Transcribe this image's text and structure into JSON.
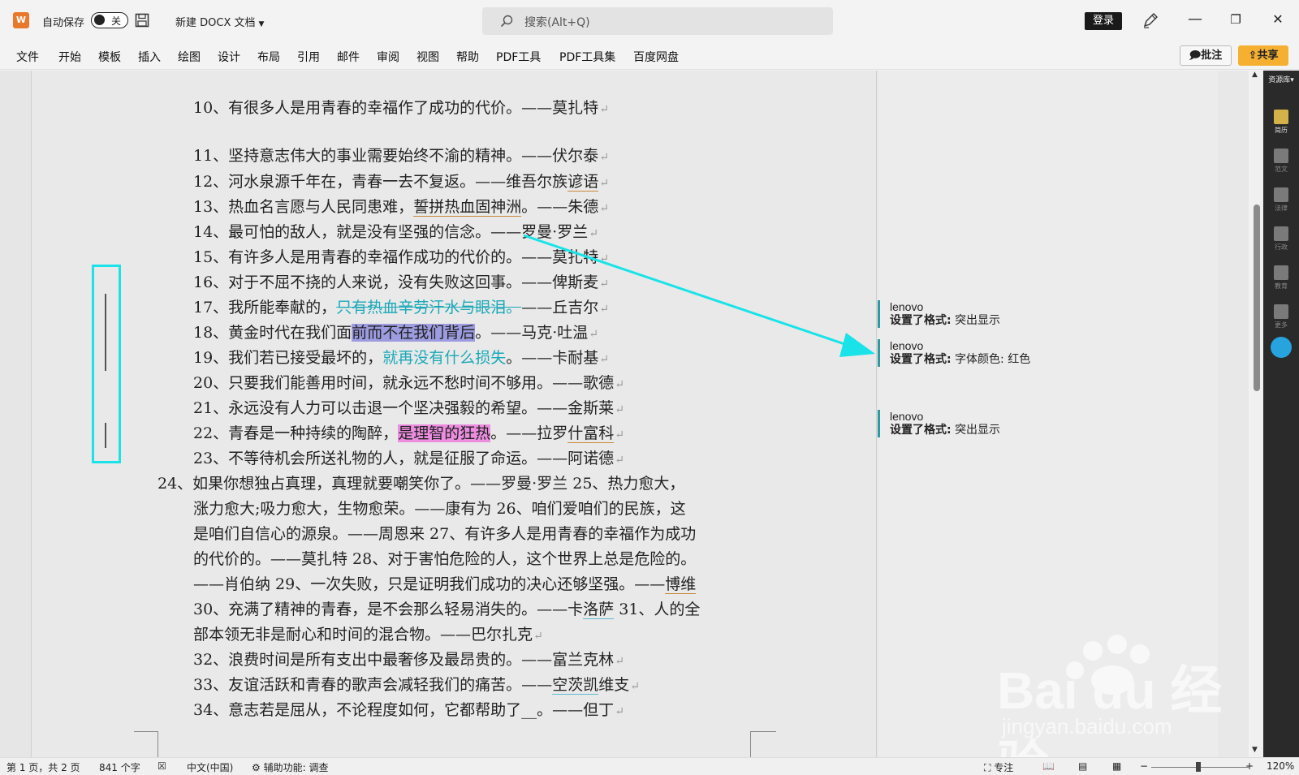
{
  "titlebar": {
    "app_icon_letter": "W",
    "autosave_label": "自动保存",
    "autosave_state": "关",
    "document_title": "新建 DOCX 文档",
    "search_placeholder": "搜索(Alt+Q)",
    "login_label": "登录",
    "minimize": "—",
    "restore": "❐",
    "close": "✕"
  },
  "menu": {
    "items": [
      "文件",
      "开始",
      "模板",
      "插入",
      "绘图",
      "设计",
      "布局",
      "引用",
      "邮件",
      "审阅",
      "视图",
      "帮助",
      "PDF工具",
      "PDF工具集",
      "百度网盘"
    ],
    "comment_label": "批注",
    "share_label": "共享"
  },
  "document": {
    "lines": {
      "l10": "10、有很多人是用青春的幸福作了成功的代价。——莫扎特",
      "l11": "11、坚持意志伟大的事业需要始终不渝的精神。——伏尔泰",
      "l12a": "12、河水泉源千年在，青春一去不复返。——维吾尔族",
      "l12b": "谚语",
      "l13a": "13、热血名言愿与人民同患难，",
      "l13b": "誓拼热血固神洲",
      "l13c": "。——朱德",
      "l14": "14、最可怕的敌人，就是没有坚强的信念。——罗曼·罗兰",
      "l15": "15、有许多人是用青春的幸福作成功的代价的。——莫扎特",
      "l16": "16、对于不屈不挠的人来说，没有失败这回事。——俾斯麦",
      "l17a": "17、我所能奉献的，",
      "l17b": "只有热血辛劳汗水与眼泪。",
      "l17c": "——丘吉尔",
      "l18a": "18、黄金时代在我们面",
      "l18b": "前而不在我们背后",
      "l18c": "。——马克·吐温",
      "l19a": "19、我们若已接受最坏的，",
      "l19b": "就再没有什么损失",
      "l19c": "。——卡耐基",
      "l20": "20、只要我们能善用时间，就永远不愁时间不够用。——歌德",
      "l21": "21、永远没有人力可以击退一个坚决强毅的希望。——金斯莱",
      "l22a": "22、青春是一种持续的陶醉，",
      "l22b": "是理智的狂热",
      "l22c": "。——拉罗",
      "l22d": "什富科",
      "l23": "23、不等待机会所送礼物的人，就是征服了命运。——阿诺德",
      "l24": "24、如果你想独占真理，真理就要嘲笑你了。——罗曼·罗兰 25、热力愈大，",
      "l24b": "涨力愈大;吸力愈大，生物愈荣。——康有为 26、咱们爱咱们的民族，这",
      "l24c": "是咱们自信心的源泉。——周恩来 27、有许多人是用青春的幸福作为成功",
      "l24d": "的代价的。——莫扎特 28、对于害怕危险的人，这个世界上总是危险的。",
      "l24e": "——肖伯纳 29、一次失败，只是证明我们成功的决心还够坚强。——",
      "l24e2": "博维",
      "l30a": "30、充满了精神的青春，是不会那么轻易消失的。——卡",
      "l30b": "洛萨",
      "l30c": " 31、人的全",
      "l30d": "部本领无非是耐心和时间的混合物。——巴尔扎克",
      "l32": "32、浪费时间是所有支出中最奢侈及最昂贵的。——富兰克林",
      "l33a": "33、友谊活跃和青春的歌声会减轻我们的痛苦。——",
      "l33b": "空茨凯",
      "l33c": "维支",
      "l34": "34、意志若是屈从，不论程度如何，它都帮助了__。——但丁"
    },
    "pilcrow": "↵"
  },
  "comments": [
    {
      "author": "lenovo",
      "label": "设置了格式:",
      "value": "突出显示"
    },
    {
      "author": "lenovo",
      "label": "设置了格式:",
      "value": "字体颜色: 红色"
    },
    {
      "author": "lenovo",
      "label": "设置了格式:",
      "value": "突出显示"
    }
  ],
  "sidebar": {
    "header": "资源库",
    "items": [
      "简历",
      "范文",
      "法律",
      "行政",
      "教育",
      "更多"
    ]
  },
  "statusbar": {
    "page": "第 1 页，共 2 页",
    "words": "841 个字",
    "language": "中文(中国)",
    "accessibility": "辅助功能: 调查",
    "focus": "专注",
    "zoom": "120%"
  },
  "watermark": {
    "brand": "Bai du 经验",
    "url": "jingyan.baidu.com"
  },
  "colors": {
    "highlight_blue": "#9d9ce0",
    "highlight_pink": "#ec8de0",
    "annotation_cyan": "#19e3e8",
    "share_orange": "#f5b032"
  }
}
